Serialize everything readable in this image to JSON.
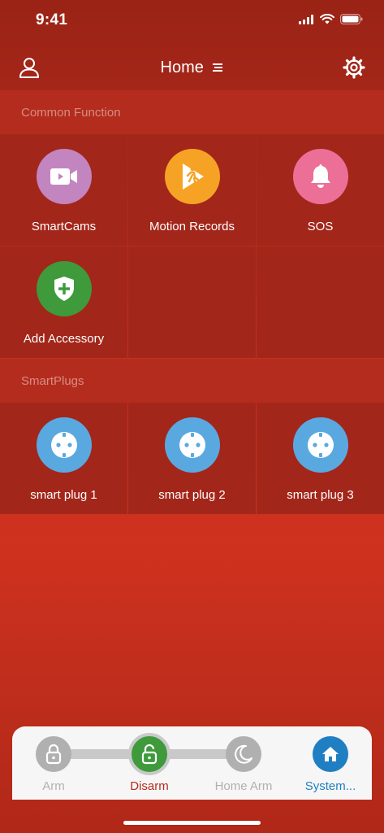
{
  "status_bar": {
    "time": "9:41"
  },
  "header": {
    "title": "Home",
    "left_icon": "user-icon",
    "right_icon": "gear-icon",
    "title_icon": "menu-icon"
  },
  "sections": {
    "common": {
      "title": "Common Function",
      "items": [
        {
          "label": "SmartCams",
          "icon": "video-camera-icon",
          "color": "#c285c0"
        },
        {
          "label": "Motion Records",
          "icon": "running-person-icon",
          "color": "#f6a325"
        },
        {
          "label": "SOS",
          "icon": "bell-icon",
          "color": "#ec6f98"
        },
        {
          "label": "Add Accessory",
          "icon": "shield-plus-icon",
          "color": "#3f9a3c"
        }
      ]
    },
    "plugs": {
      "title": "SmartPlugs",
      "items": [
        {
          "label": "smart plug 1",
          "icon": "socket-icon",
          "color": "#5aa8e0"
        },
        {
          "label": "smart plug 2",
          "icon": "socket-icon",
          "color": "#5aa8e0"
        },
        {
          "label": "smart plug 3",
          "icon": "socket-icon",
          "color": "#5aa8e0"
        }
      ]
    }
  },
  "modes": {
    "arm": {
      "label": "Arm",
      "icon": "lock-icon",
      "color": "#b0b0b0"
    },
    "disarm": {
      "label": "Disarm",
      "icon": "unlock-icon",
      "color": "#3f9a3c",
      "label_color": "#b52b1c",
      "active": true
    },
    "home_arm": {
      "label": "Home Arm",
      "icon": "moon-icon",
      "color": "#b0b0b0"
    },
    "system": {
      "label": "System...",
      "icon": "house-icon",
      "color": "#1f7fc2",
      "label_color": "#1f7fc2"
    }
  },
  "colors": {
    "accent_red": "#b52b1c",
    "inactive_gray": "#b0b0b0"
  }
}
